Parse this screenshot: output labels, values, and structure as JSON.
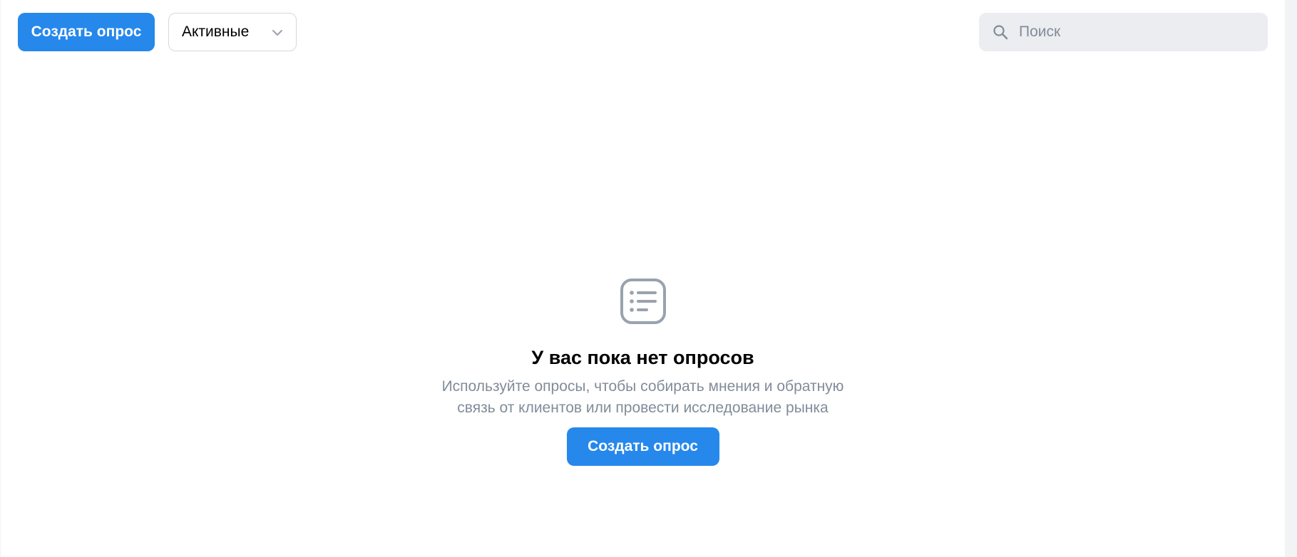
{
  "toolbar": {
    "create_button_label": "Создать опрос",
    "filter": {
      "selected": "Активные"
    },
    "search": {
      "placeholder": "Поиск",
      "value": ""
    }
  },
  "empty_state": {
    "icon": "list-icon",
    "title": "У вас пока нет опросов",
    "description": "Используйте опросы, чтобы собирать мнения и обратную связь от клиентов или провести исследование рынка",
    "button_label": "Создать опрос"
  },
  "colors": {
    "accent": "#2688eb",
    "muted_text": "#818c99",
    "icon_gray": "#99a2ad",
    "search_bg": "#ebedf0",
    "border": "#d7d8db"
  }
}
